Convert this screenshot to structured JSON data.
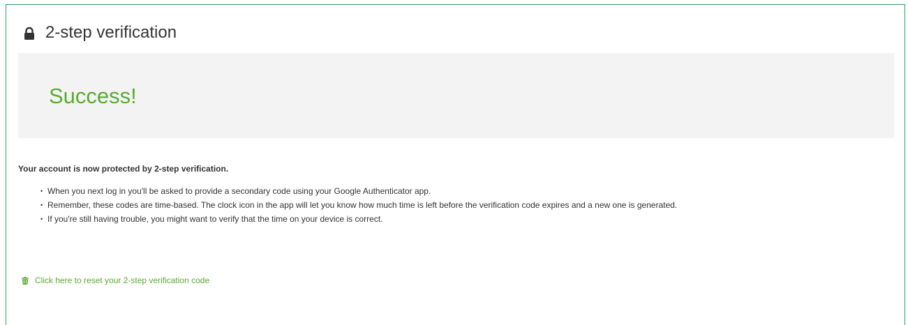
{
  "header": {
    "title": "2-step verification",
    "icon": "lock-icon"
  },
  "success": {
    "title": "Success!",
    "background": "#f3f3f3",
    "color": "#5aab2e"
  },
  "body": {
    "protected_text": "Your account is now protected by 2-step verification.",
    "bullets": [
      "When you next log in you'll be asked to provide a secondary code using your Google Authenticator app.",
      "Remember, these codes are time-based. The clock icon in the app will let you know how much time is left before the verification code expires and a new one is generated.",
      "If you're still having trouble, you might want to verify that the time on your device is correct."
    ]
  },
  "reset_link": {
    "label": "Click here to reset your 2-step verification code",
    "icon": "trash-icon",
    "color": "#5aab2e"
  },
  "colors": {
    "border": "#2e9e5b",
    "text": "#333333"
  }
}
